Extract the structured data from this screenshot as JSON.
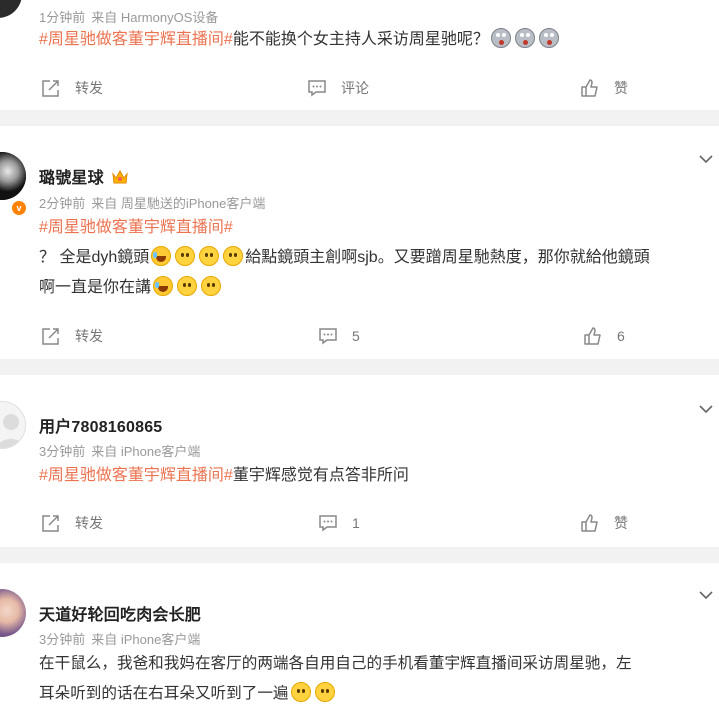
{
  "colors": {
    "topic": "#eb7350",
    "meta": "#999999",
    "accent_badge": "#ff8200"
  },
  "posts": [
    {
      "meta": {
        "time": "1分钟前",
        "source": "来自 HarmonyOS设备"
      },
      "topic": "#周星驰做客董宇辉直播间#",
      "text": "能不能换个女主持人采访周星驰呢？",
      "emojis": [
        "shock-emoji",
        "shock-emoji",
        "shock-emoji"
      ],
      "actions": {
        "repost": "转发",
        "comment": "评论",
        "like": "赞"
      }
    },
    {
      "user": "璐號星球",
      "meta": {
        "time": "2分钟前",
        "source": "来自 周星馳送的iPhone客户端"
      },
      "topic": "#周星驰做客董宇辉直播间#",
      "text_a": "？ 全是dyh鏡頭",
      "text_b": "給點鏡頭主創啊sjb。又要蹭周星馳熱度，那你就給他鏡頭",
      "text_c": "啊一直是你在講",
      "actions": {
        "repost": "转发",
        "comment": "5",
        "like": "6"
      }
    },
    {
      "user": "用户7808160865",
      "meta": {
        "time": "3分钟前",
        "source": "来自 iPhone客户端"
      },
      "topic": "#周星驰做客董宇辉直播间#",
      "text": "董宇辉感觉有点答非所问",
      "actions": {
        "repost": "转发",
        "comment": "1",
        "like": "赞"
      }
    },
    {
      "user": "天道好轮回吃肉会长肥",
      "meta": {
        "time": "3分钟前",
        "source": "来自 iPhone客户端"
      },
      "text_a": "在干鼠么，我爸和我妈在客厅的两端各自用自己的手机看董宇辉直播间采访周星驰，左",
      "text_b": "耳朵听到的话在右耳朵又听到了一遍"
    }
  ]
}
